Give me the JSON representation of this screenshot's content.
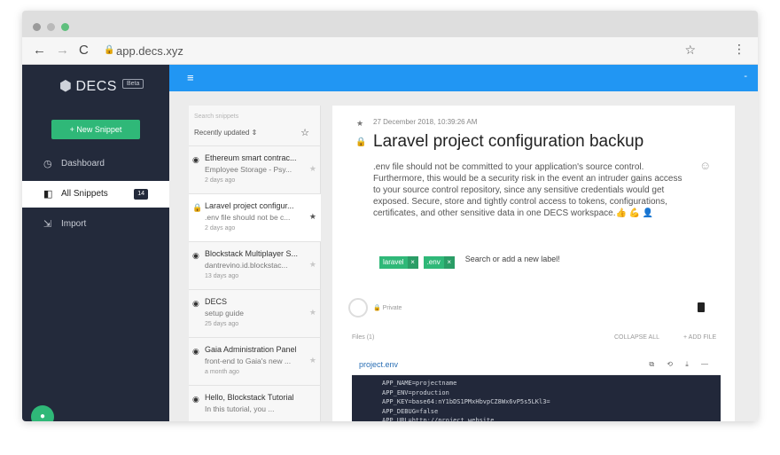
{
  "browser": {
    "url": "app.decs.xyz",
    "back_icon": "←",
    "forward_icon": "→",
    "reload_icon": "C",
    "star_icon": "☆",
    "menu_icon": "⋮"
  },
  "sidebar": {
    "logo": "DECS",
    "beta": "Beta",
    "new_snippet": "+ New Snippet",
    "items": [
      {
        "label": "Dashboard",
        "icon": "◷"
      },
      {
        "label": "All Snippets",
        "icon": "◧",
        "count": "14"
      },
      {
        "label": "Import",
        "icon": "⇲"
      }
    ]
  },
  "topbar": {
    "menu_icon": "≡",
    "right": "-"
  },
  "list": {
    "search_placeholder": "Search snippets",
    "sort_label": "Recently updated ⇕",
    "snippets": [
      {
        "icon": "🌐",
        "title": "Ethereum smart contrac...",
        "desc": "Employee Storage - Psy...",
        "date": "2 days ago"
      },
      {
        "icon": "🔒",
        "title": "Laravel project configur...",
        "desc": ".env file should not be c...",
        "date": "2 days ago"
      },
      {
        "icon": "🌐",
        "title": "Blockstack Multiplayer S...",
        "desc": "dantrevino.id.blockstac...",
        "date": "13 days ago"
      },
      {
        "icon": "🌐",
        "title": "DECS",
        "desc": "setup guide",
        "date": "25 days ago"
      },
      {
        "icon": "🌐",
        "title": "Gaia Administration Panel",
        "desc": "front-end to Gaia's new ...",
        "date": "a month ago"
      },
      {
        "icon": "🌐",
        "title": "Hello, Blockstack Tutorial",
        "desc": "In this tutorial, you ...",
        "date": ""
      }
    ]
  },
  "detail": {
    "date": "27 December 2018, 10:39:26 AM",
    "title": "Laravel project configuration backup",
    "description": ".env file should not be committed to your application's source control. Furthermore, this would be a security risk in the event an intruder gains access to your source control repository, since any sensitive credentials would get exposed. Secure, store and tightly control access to tokens, configurations, certificates, and other sensitive data in one DECS workspace.👍 💪 👤",
    "labels": [
      "laravel",
      ".env"
    ],
    "label_remove": "×",
    "label_input": "Search or add a new label!",
    "private": "🔒 Private",
    "files_label": "Files (1)",
    "collapse_all": "COLLAPSE ALL",
    "add_file": "+ ADD FILE",
    "file_name": "project.env",
    "file_tools": "⧉ ⟲ ⤓ —",
    "code": "APP_NAME=projectname\nAPP_ENV=production\nAPP_KEY=base64:nY1bDS1PMxHbvpCZ8Wx6vP5s5LKl3=\nAPP_DEBUG=false\nAPP_URL=http://project.website"
  },
  "colors": {
    "accent": "#2196f3",
    "green": "#2fb878",
    "sidebar": "#232a3b"
  }
}
